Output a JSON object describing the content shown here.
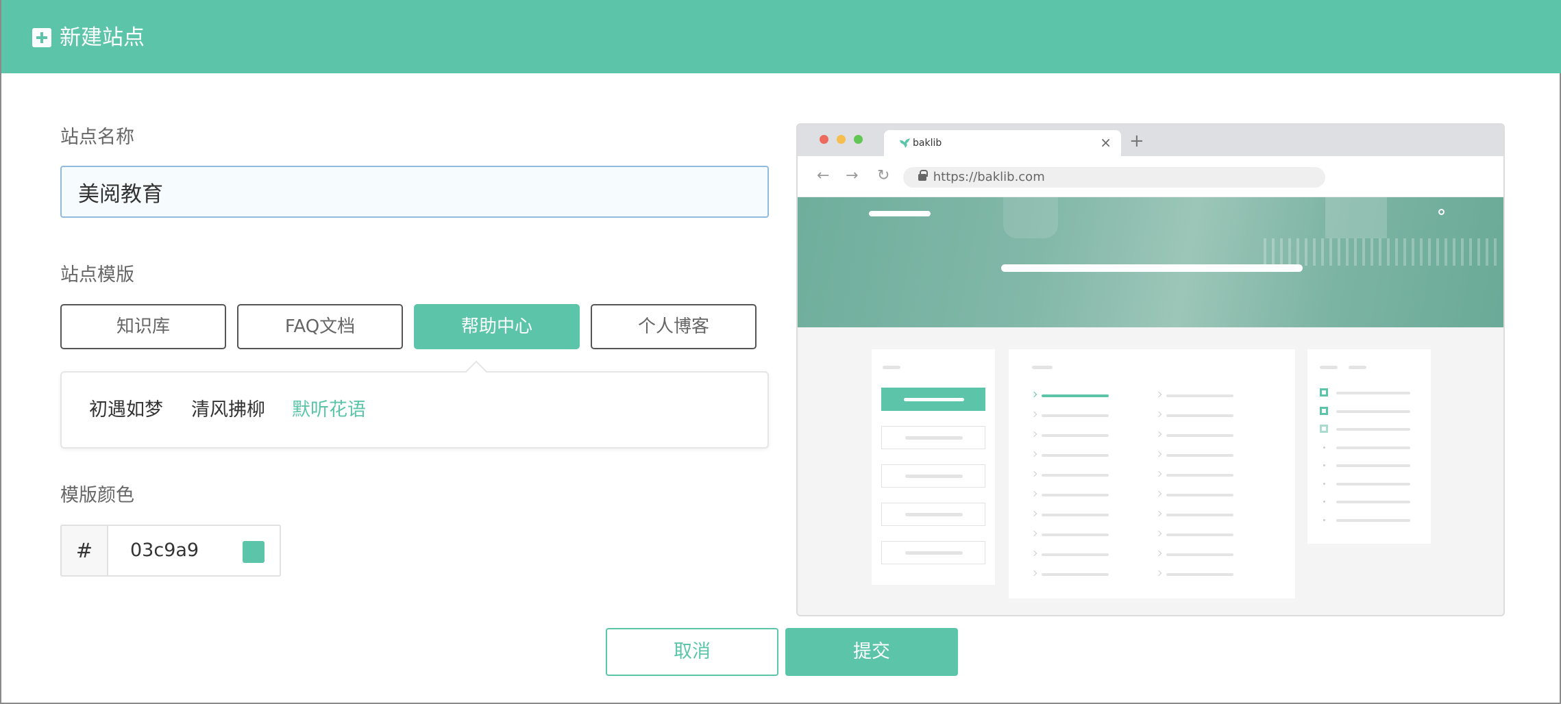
{
  "dialog": {
    "title": "新建站点",
    "site_name_label": "站点名称",
    "site_name_value": "美阅教育",
    "template_label": "站点模版",
    "templates": [
      {
        "label": "知识库",
        "active": false
      },
      {
        "label": "FAQ文档",
        "active": false
      },
      {
        "label": "帮助中心",
        "active": true
      },
      {
        "label": "个人博客",
        "active": false
      }
    ],
    "sub_templates": [
      {
        "label": "初遇如梦",
        "active": false
      },
      {
        "label": "清风拂柳",
        "active": false
      },
      {
        "label": "默听花语",
        "active": true
      }
    ],
    "color_label": "模版颜色",
    "color_prefix": "#",
    "color_value": "03c9a9",
    "cancel_label": "取消",
    "submit_label": "提交"
  },
  "preview": {
    "tab_title": "baklib",
    "tab_close": "×",
    "new_tab": "+",
    "url": "https://baklib.com",
    "back_glyph": "←",
    "forward_glyph": "→",
    "reload_glyph": "↻"
  },
  "colors": {
    "accent": "#5cc5a9",
    "input_border": "#8fb9de",
    "traffic_red": "#ee6a5f",
    "traffic_yellow": "#f5be4f",
    "traffic_green": "#62c655"
  }
}
